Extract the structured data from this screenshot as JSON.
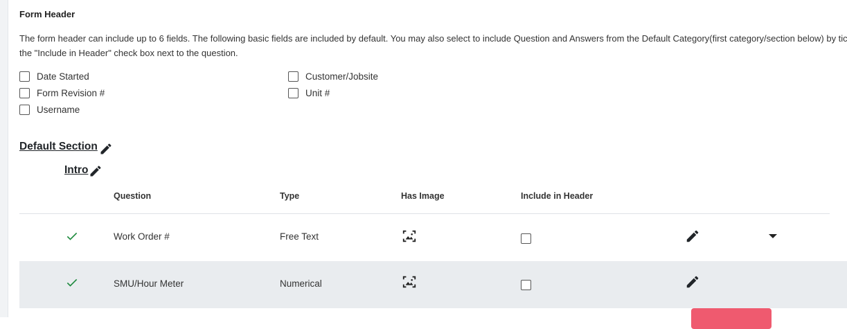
{
  "form_header": {
    "title": "Form Header",
    "description": "The form header can include up to 6 fields. The following basic fields are included by default. You may also select to include Question and Answers from the Default Category(first category/section below) by ticking the \"Include in Header\" check box next to the question.",
    "fields": [
      {
        "label": "Date Started",
        "checked": false
      },
      {
        "label": "Customer/Jobsite",
        "checked": false
      },
      {
        "label": "Form Revision #",
        "checked": false
      },
      {
        "label": "Unit #",
        "checked": false
      },
      {
        "label": "Username",
        "checked": false
      }
    ]
  },
  "section": {
    "title": "Default Section",
    "category": "Intro"
  },
  "table": {
    "headers": [
      "Question",
      "Type",
      "Has Image",
      "Include in Header"
    ],
    "rows": [
      {
        "question": "Work Order #",
        "type": "Free Text",
        "has_image": true,
        "include_in_header": false,
        "active": true,
        "has_caret": true
      },
      {
        "question": "SMU/Hour Meter",
        "type": "Numerical",
        "has_image": true,
        "include_in_header": false,
        "active": true,
        "has_caret": false
      }
    ]
  },
  "icons": {
    "section_edit": "pencil-icon",
    "row_status": "check-icon",
    "has_image": "image-placeholder-icon",
    "row_menu": "caret-down-icon"
  },
  "colors": {
    "check": "#1e8a3e",
    "alt_row": "#e9ecef",
    "danger": "#ef5a6f"
  }
}
